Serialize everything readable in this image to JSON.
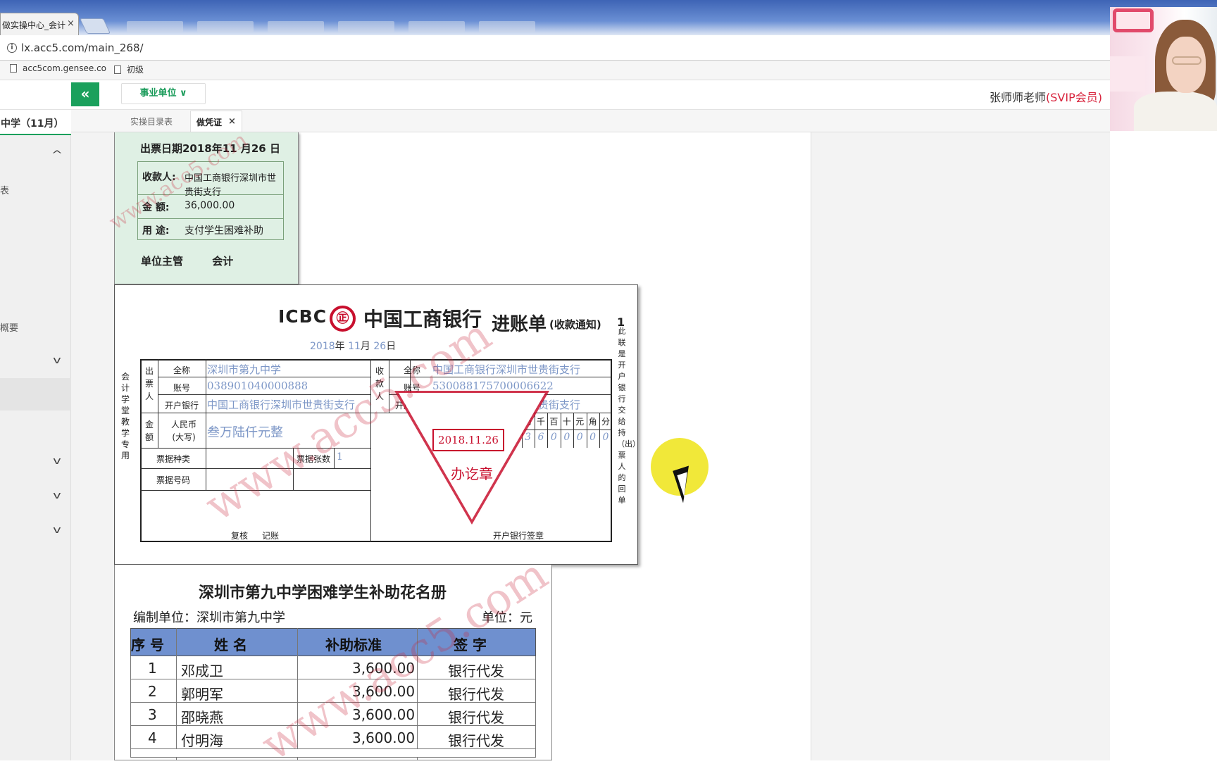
{
  "browser": {
    "tab_title": "做实操中心_会计",
    "tab_close": "×",
    "url": "lx.acc5.com/main_268/",
    "info_icon": "i",
    "bookmarks": [
      "acc5com.gensee.co",
      "初级"
    ]
  },
  "header": {
    "collapse_icon": "«",
    "unit_select": "事业单位 ∨",
    "teacher": "张师师老师",
    "member_badge": "(SVIP会员)"
  },
  "sidebar": {
    "school": "中学（11月）",
    "items": [
      "表",
      "概要"
    ],
    "chevron_up": "^",
    "chevron_down": "v"
  },
  "tabs": {
    "catalog": "实操目录表",
    "voucher": "做凭证",
    "voucher_close": "×"
  },
  "stub": {
    "date": "出票日期2018年11 月26  日",
    "payee_label": "收款人:",
    "payee": "中国工商银行深圳市世",
    "payee2": "贵街支行",
    "amount_label": "金    额:",
    "amount": "36,000.00",
    "purpose_label": "用    途:",
    "purpose": "支付学生困难补助",
    "sign": "单位主管 会计"
  },
  "slip": {
    "icbc": "ICBC",
    "logo": "㊣",
    "bank": "中国工商银行",
    "title": "进账单",
    "subtitle": "(收款通知)",
    "copy_no": "1",
    "date": {
      "year": "2018",
      "y": "年",
      "month": "11",
      "m": "月",
      "day": "26",
      "d": "日"
    },
    "left_vertical": "会计学堂教学专用",
    "right_vertical": "此联是开户银行交给持（出）票人的回单",
    "payer_label": "出票人",
    "payee_label": "收款人",
    "full_name": "全称",
    "account": "账号",
    "open_bank": "开户银行",
    "payer_name": "深圳市第九中学",
    "payer_account": "038901040000888",
    "payer_bank": "中国工商银行深圳市世贵街支行",
    "payee_name": "中国工商银行深圳市世贵街支行",
    "payee_account": "530088175700006622",
    "payee_bank": "中国工商银行深圳市世贵街支行",
    "amount_label": "金额",
    "rmb_label": "人民币",
    "rmb_label2": "(大写)",
    "amount_words": "叁万陆仟元整",
    "digit_headers": [
      "亿",
      "千",
      "百",
      "十",
      "万",
      "千",
      "百",
      "十",
      "元",
      "角",
      "分"
    ],
    "digit_values": [
      "",
      "",
      "",
      "¥",
      "3",
      "6",
      "0",
      "0",
      "0",
      "0",
      "0"
    ],
    "bill_type": "票据种类",
    "bill_count": "票据张数",
    "bill_count_val": "1",
    "bill_no": "票据号码",
    "review": "复核",
    "bookkeep": "记账",
    "bank_stamp": "开户银行签章",
    "stamp_date": "2018.11.26",
    "stamp_text": "办讫章"
  },
  "roster": {
    "title": "深圳市第九中学困难学生补助花名册",
    "unit": "编制单位：深圳市第九中学",
    "currency": "单位：元",
    "headers": [
      "序  号",
      "姓  名",
      "补助标准",
      "签  字"
    ],
    "rows": [
      {
        "no": "1",
        "name": "邓成卫",
        "amount": "3,600.00",
        "sign": "银行代发"
      },
      {
        "no": "2",
        "name": "郭明军",
        "amount": "3,600.00",
        "sign": "银行代发"
      },
      {
        "no": "3",
        "name": "邵晓燕",
        "amount": "3,600.00",
        "sign": "银行代发"
      },
      {
        "no": "4",
        "name": "付明海",
        "amount": "3,600.00",
        "sign": "银行代发"
      }
    ]
  },
  "watermark": "www.acc5.com"
}
